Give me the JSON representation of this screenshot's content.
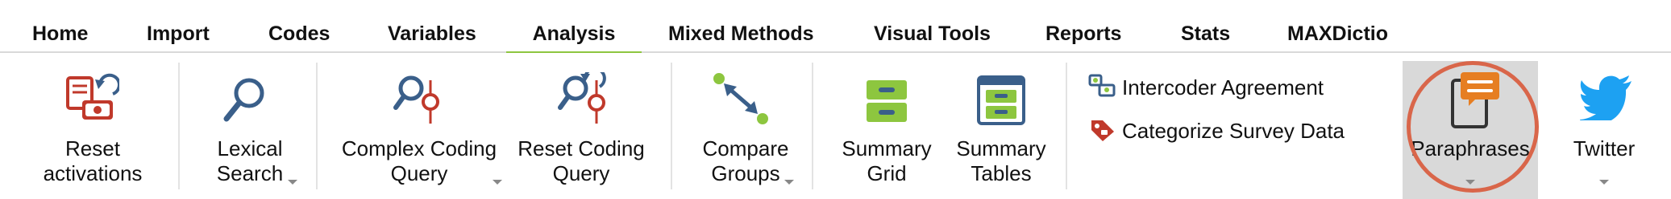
{
  "tabs": [
    "Home",
    "Import",
    "Codes",
    "Variables",
    "Analysis",
    "Mixed Methods",
    "Visual Tools",
    "Reports",
    "Stats",
    "MAXDictio"
  ],
  "active_tab": "Analysis",
  "ribbon": {
    "reset_activations": [
      "Reset",
      "activations"
    ],
    "lexical_search": [
      "Lexical",
      "Search"
    ],
    "complex_coding_query": [
      "Complex Coding",
      "Query"
    ],
    "reset_coding_query": [
      "Reset Coding",
      "Query"
    ],
    "compare_groups": [
      "Compare",
      "Groups"
    ],
    "summary_grid": [
      "Summary",
      "Grid"
    ],
    "summary_tables": [
      "Summary",
      "Tables"
    ],
    "intercoder_agreement": "Intercoder Agreement",
    "categorize_survey_data": "Categorize Survey Data",
    "paraphrases": "Paraphrases",
    "twitter": "Twitter"
  },
  "colors": {
    "active_tab_underline": "#8dc63f",
    "highlight_ellipse": "#d9664a",
    "icon_blue": "#3a5f8a",
    "icon_green": "#8dc63f",
    "icon_red": "#c0392b",
    "twitter_blue": "#1da1f2",
    "paraphrase_orange": "#e67e22"
  }
}
